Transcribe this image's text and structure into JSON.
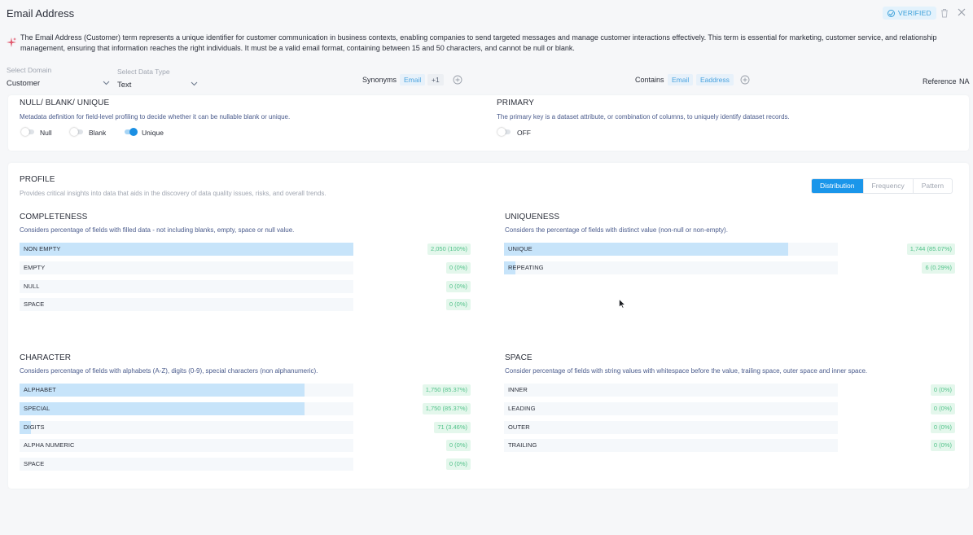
{
  "header": {
    "title": "Email Address",
    "verified_label": "VERIFIED"
  },
  "description": "The Email Address (Customer) term represents a unique identifier for customer communication in business contexts, enabling companies to send targeted messages and manage customer interactions effectively. This term is essential for marketing, customer service, and relationship management, ensuring that information reaches the right individuals. It must be a valid email format, containing between 15 and 50 characters, and cannot be null or blank.",
  "domain": {
    "label": "Select Domain",
    "value": "Customer"
  },
  "data_type": {
    "label": "Select Data Type",
    "value": "Text"
  },
  "synonyms": {
    "label": "Synonyms",
    "chips": [
      "Email",
      "+1"
    ]
  },
  "contains": {
    "label": "Contains",
    "chips": [
      "Email",
      "Eaddress"
    ]
  },
  "reference": {
    "label": "Reference",
    "value": "NA"
  },
  "null_blank_unique": {
    "title": "NULL/ BLANK/ UNIQUE",
    "description": "Metadata definition for field-level profiling to decide whether it can be nullable blank or unique.",
    "toggles": [
      {
        "label": "Null",
        "on": false
      },
      {
        "label": "Blank",
        "on": false
      },
      {
        "label": "Unique",
        "on": true
      }
    ]
  },
  "primary": {
    "title": "PRIMARY",
    "description": "The primary key is a dataset attribute, or combination of columns, to uniquely identify dataset records.",
    "toggle_label": "OFF",
    "on": false
  },
  "profile": {
    "title": "PROFILE",
    "description": "Provides critical insights into data that aids in the discovery of data quality issues, risks, and overall trends.",
    "tabs": [
      "Distribution",
      "Frequency",
      "Pattern"
    ],
    "active_tab": "Distribution"
  },
  "completeness": {
    "title": "COMPLETENESS",
    "description": "Considers percentage of fields with filled data - not including blanks, empty, space or null value.",
    "rows": [
      {
        "label": "NON EMPTY",
        "value": "2,050 (100%)",
        "fraction": 1.0
      },
      {
        "label": "EMPTY",
        "value": "0 (0%)",
        "fraction": 0
      },
      {
        "label": "NULL",
        "value": "0 (0%)",
        "fraction": 0
      },
      {
        "label": "SPACE",
        "value": "0 (0%)",
        "fraction": 0
      }
    ]
  },
  "uniqueness": {
    "title": "UNIQUENESS",
    "description": "Considers the percentage of fields with distinct value (non-null or non-empty).",
    "rows": [
      {
        "label": "UNIQUE",
        "value": "1,744 (85.07%)",
        "fraction": 0.8507
      },
      {
        "label": "REPEATING",
        "value": "6 (0.29%)",
        "fraction": 0.0029
      }
    ]
  },
  "character": {
    "title": "CHARACTER",
    "description": "Considers percentage of fields with alphabets (A-Z), digits (0-9), special characters (non alphanumeric).",
    "rows": [
      {
        "label": "ALPHABET",
        "value": "1,750 (85.37%)",
        "fraction": 0.8537
      },
      {
        "label": "SPECIAL",
        "value": "1,750 (85.37%)",
        "fraction": 0.8537
      },
      {
        "label": "DIGITS",
        "value": "71 (3.46%)",
        "fraction": 0.0346
      },
      {
        "label": "ALPHA NUMERIC",
        "value": "0 (0%)",
        "fraction": 0
      },
      {
        "label": "SPACE",
        "value": "0 (0%)",
        "fraction": 0
      }
    ]
  },
  "space": {
    "title": "SPACE",
    "description": "Consider percentage of fields with string values with whitespace before the value, trailing space, outer space and inner space.",
    "rows": [
      {
        "label": "INNER",
        "value": "0 (0%)",
        "fraction": 0
      },
      {
        "label": "LEADING",
        "value": "0 (0%)",
        "fraction": 0
      },
      {
        "label": "OUTER",
        "value": "0 (0%)",
        "fraction": 0
      },
      {
        "label": "TRAILING",
        "value": "0 (0%)",
        "fraction": 0
      }
    ]
  }
}
